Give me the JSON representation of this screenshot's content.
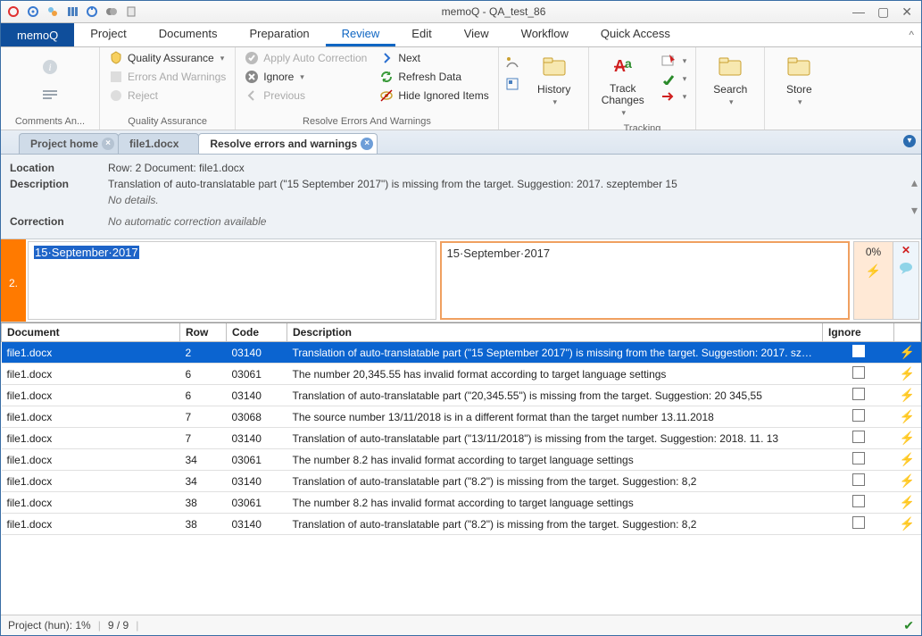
{
  "title": "memoQ - QA_test_86",
  "app_tab": "memoQ",
  "menu_tabs": [
    "Project",
    "Documents",
    "Preparation",
    "Review",
    "Edit",
    "View",
    "Workflow",
    "Quick Access"
  ],
  "menu_active": 3,
  "ribbon": {
    "comments": {
      "label": "Comments An..."
    },
    "qa_group": {
      "label": "Quality Assurance",
      "qa": "Quality Assurance",
      "errors": "Errors And Warnings",
      "reject": "Reject"
    },
    "resolve_group": {
      "label": "Resolve Errors And Warnings",
      "apply": "Apply Auto Correction",
      "ignore": "Ignore",
      "previous": "Previous",
      "next": "Next",
      "refresh": "Refresh Data",
      "hide": "Hide Ignored Items"
    },
    "history": {
      "label": "History"
    },
    "tracking": {
      "label": "Tracking",
      "track": "Track\nChanges"
    },
    "search": {
      "label": "Search"
    },
    "store": {
      "label": "Store"
    }
  },
  "doc_tabs": [
    {
      "label": "Project home",
      "active": false,
      "closable": true
    },
    {
      "label": "file1.docx",
      "active": false,
      "closable": false
    },
    {
      "label": "Resolve errors and warnings",
      "active": true,
      "closable": true
    }
  ],
  "detail": {
    "location_label": "Location",
    "location_value": "Row: 2  Document:  file1.docx",
    "description_label": "Description",
    "description_value": "Translation of auto-translatable part (\"15 September 2017\") is missing from the target. Suggestion: 2017. szeptember 15",
    "no_details": "No details.",
    "correction_label": "Correction",
    "correction_value": "No automatic correction available"
  },
  "editor": {
    "row": "2.",
    "source": "15·September·2017",
    "target": "15·September·2017",
    "match": "0%"
  },
  "columns": {
    "doc": "Document",
    "row": "Row",
    "code": "Code",
    "desc": "Description",
    "ignore": "Ignore"
  },
  "rows": [
    {
      "doc": "file1.docx",
      "row": "2",
      "code": "03140",
      "desc": "Translation of auto-translatable part (\"15 September 2017\") is missing from the target. Suggestion: 2017. szepte...",
      "selected": true
    },
    {
      "doc": "file1.docx",
      "row": "6",
      "code": "03061",
      "desc": "The number 20,345.55 has invalid format according to target language settings"
    },
    {
      "doc": "file1.docx",
      "row": "6",
      "code": "03140",
      "desc": "Translation of auto-translatable part (\"20,345.55\") is missing from the target. Suggestion: 20 345,55"
    },
    {
      "doc": "file1.docx",
      "row": "7",
      "code": "03068",
      "desc": "The source number 13/11/2018 is in a different format than the target number 13.11.2018"
    },
    {
      "doc": "file1.docx",
      "row": "7",
      "code": "03140",
      "desc": "Translation of auto-translatable part (\"13/11/2018\") is missing from the target. Suggestion: 2018. 11. 13"
    },
    {
      "doc": "file1.docx",
      "row": "34",
      "code": "03061",
      "desc": "The number 8.2 has invalid format according to target language settings"
    },
    {
      "doc": "file1.docx",
      "row": "34",
      "code": "03140",
      "desc": "Translation of auto-translatable part (\"8.2\") is missing from the target. Suggestion: 8,2"
    },
    {
      "doc": "file1.docx",
      "row": "38",
      "code": "03061",
      "desc": "The number 8.2 has invalid format according to target language settings"
    },
    {
      "doc": "file1.docx",
      "row": "38",
      "code": "03140",
      "desc": "Translation of auto-translatable part (\"8.2\") is missing from the target. Suggestion: 8,2"
    }
  ],
  "status": {
    "project": "Project (hun): 1%",
    "count": "9 / 9"
  }
}
